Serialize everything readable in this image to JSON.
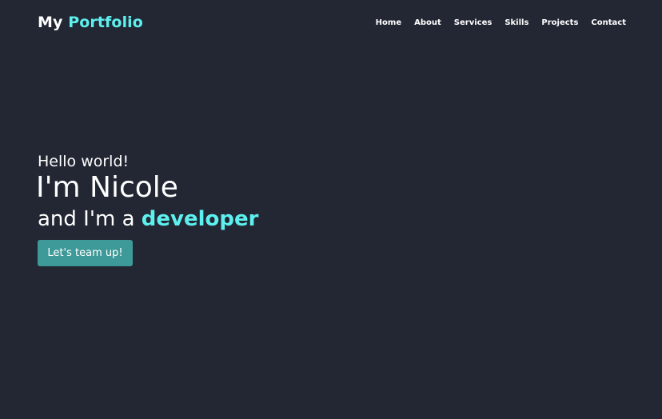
{
  "header": {
    "logo_part1": "My ",
    "logo_part2": "Portfolio",
    "nav": [
      "Home",
      "About",
      "Services",
      "Skills",
      "Projects",
      "Contact"
    ]
  },
  "hero": {
    "greeting": "Hello world!",
    "name": "I'm Nicole",
    "role_prefix": "and I'm a ",
    "role": "developer",
    "cta_label": "Let's team up!"
  },
  "colors": {
    "background": "#222733",
    "accent": "#5ef0ee",
    "button": "#3e9a98",
    "text": "#ffffff"
  }
}
